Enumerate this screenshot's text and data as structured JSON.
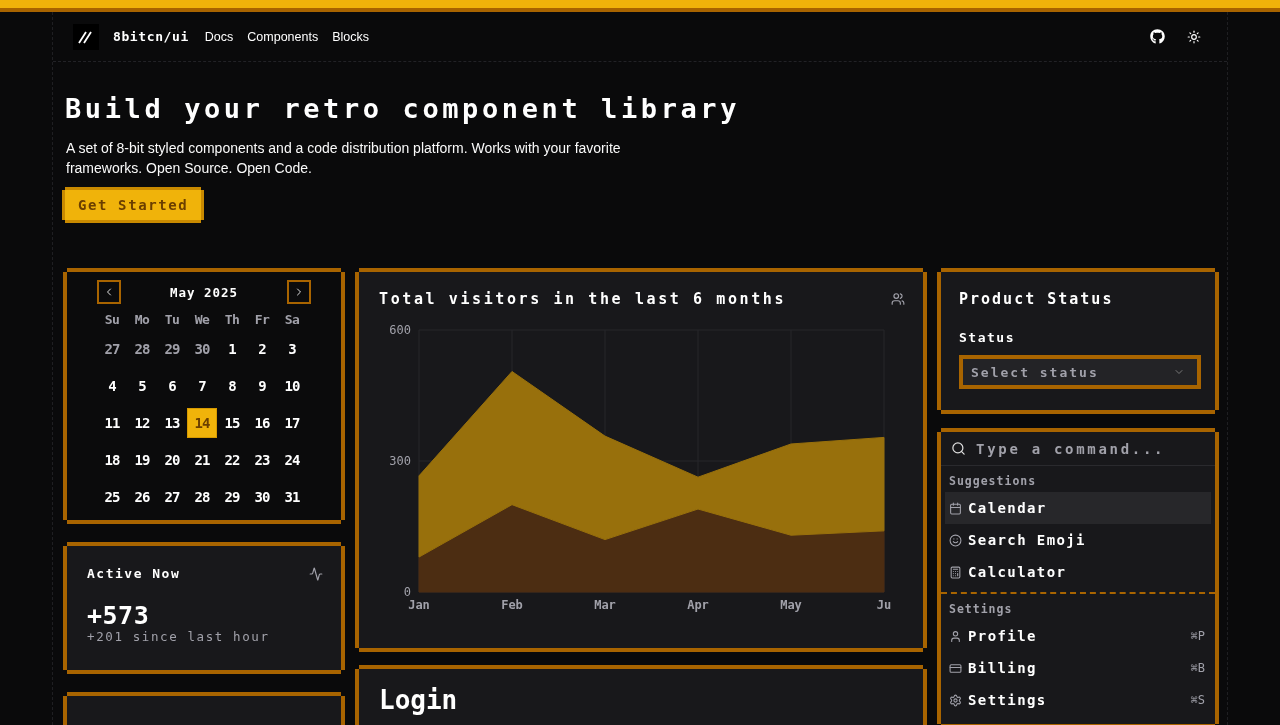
{
  "nav": {
    "logo": "8bitcn/ui",
    "links": [
      "Docs",
      "Components",
      "Blocks"
    ]
  },
  "hero": {
    "title": "Build your retro component library",
    "description": "A set of 8-bit styled components and a code distribution platform. Works with your favorite frameworks. Open Source. Open Code.",
    "cta": "Get Started"
  },
  "calendar": {
    "month": "May 2025",
    "weekdays": [
      "Su",
      "Mo",
      "Tu",
      "We",
      "Th",
      "Fr",
      "Sa"
    ],
    "weeks": [
      [
        {
          "day": "27",
          "outside": true,
          "selected": false
        },
        {
          "day": "28",
          "outside": true,
          "selected": false
        },
        {
          "day": "29",
          "outside": true,
          "selected": false
        },
        {
          "day": "30",
          "outside": true,
          "selected": false
        },
        {
          "day": "1",
          "outside": false,
          "selected": false
        },
        {
          "day": "2",
          "outside": false,
          "selected": false
        },
        {
          "day": "3",
          "outside": false,
          "selected": false
        }
      ],
      [
        {
          "day": "4",
          "outside": false,
          "selected": false
        },
        {
          "day": "5",
          "outside": false,
          "selected": false
        },
        {
          "day": "6",
          "outside": false,
          "selected": false
        },
        {
          "day": "7",
          "outside": false,
          "selected": false
        },
        {
          "day": "8",
          "outside": false,
          "selected": false
        },
        {
          "day": "9",
          "outside": false,
          "selected": false
        },
        {
          "day": "10",
          "outside": false,
          "selected": false
        }
      ],
      [
        {
          "day": "11",
          "outside": false,
          "selected": false
        },
        {
          "day": "12",
          "outside": false,
          "selected": false
        },
        {
          "day": "13",
          "outside": false,
          "selected": false
        },
        {
          "day": "14",
          "outside": false,
          "selected": true
        },
        {
          "day": "15",
          "outside": false,
          "selected": false
        },
        {
          "day": "16",
          "outside": false,
          "selected": false
        },
        {
          "day": "17",
          "outside": false,
          "selected": false
        }
      ],
      [
        {
          "day": "18",
          "outside": false,
          "selected": false
        },
        {
          "day": "19",
          "outside": false,
          "selected": false
        },
        {
          "day": "20",
          "outside": false,
          "selected": false
        },
        {
          "day": "21",
          "outside": false,
          "selected": false
        },
        {
          "day": "22",
          "outside": false,
          "selected": false
        },
        {
          "day": "23",
          "outside": false,
          "selected": false
        },
        {
          "day": "24",
          "outside": false,
          "selected": false
        }
      ],
      [
        {
          "day": "25",
          "outside": false,
          "selected": false
        },
        {
          "day": "26",
          "outside": false,
          "selected": false
        },
        {
          "day": "27",
          "outside": false,
          "selected": false
        },
        {
          "day": "28",
          "outside": false,
          "selected": false
        },
        {
          "day": "29",
          "outside": false,
          "selected": false
        },
        {
          "day": "30",
          "outside": false,
          "selected": false
        },
        {
          "day": "31",
          "outside": false,
          "selected": false
        }
      ]
    ]
  },
  "active_now": {
    "title": "Active Now",
    "value": "+573",
    "note": "+201 since last hour"
  },
  "visitors": {
    "title": "Total visitors in the last 6 months",
    "chart_data": {
      "type": "area",
      "stacked": true,
      "grid": true,
      "categories": [
        "Jan",
        "Feb",
        "Mar",
        "Apr",
        "May",
        "Ju"
      ],
      "ylim": [
        0,
        600
      ],
      "yticks": [
        0,
        300,
        600
      ],
      "series": [
        {
          "color": "#4c2d12",
          "values": [
            80,
            200,
            120,
            190,
            130,
            140
          ]
        },
        {
          "color": "#98700c",
          "values": [
            186,
            305,
            237,
            73,
            209,
            214
          ]
        }
      ]
    }
  },
  "login": {
    "title": "Login"
  },
  "product_status": {
    "title": "Product Status",
    "label": "Status",
    "placeholder": "Select status"
  },
  "command": {
    "placeholder": "Type a command...",
    "groups": [
      {
        "heading": "Suggestions",
        "items": [
          {
            "label": "Calendar",
            "selected": true
          },
          {
            "label": "Search Emoji",
            "selected": false
          },
          {
            "label": "Calculator",
            "selected": false
          }
        ]
      },
      {
        "heading": "Settings",
        "items": [
          {
            "label": "Profile",
            "shortcut": "⌘P",
            "selected": false
          },
          {
            "label": "Billing",
            "shortcut": "⌘B",
            "selected": false
          },
          {
            "label": "Settings",
            "shortcut": "⌘S",
            "selected": false
          }
        ]
      }
    ]
  }
}
